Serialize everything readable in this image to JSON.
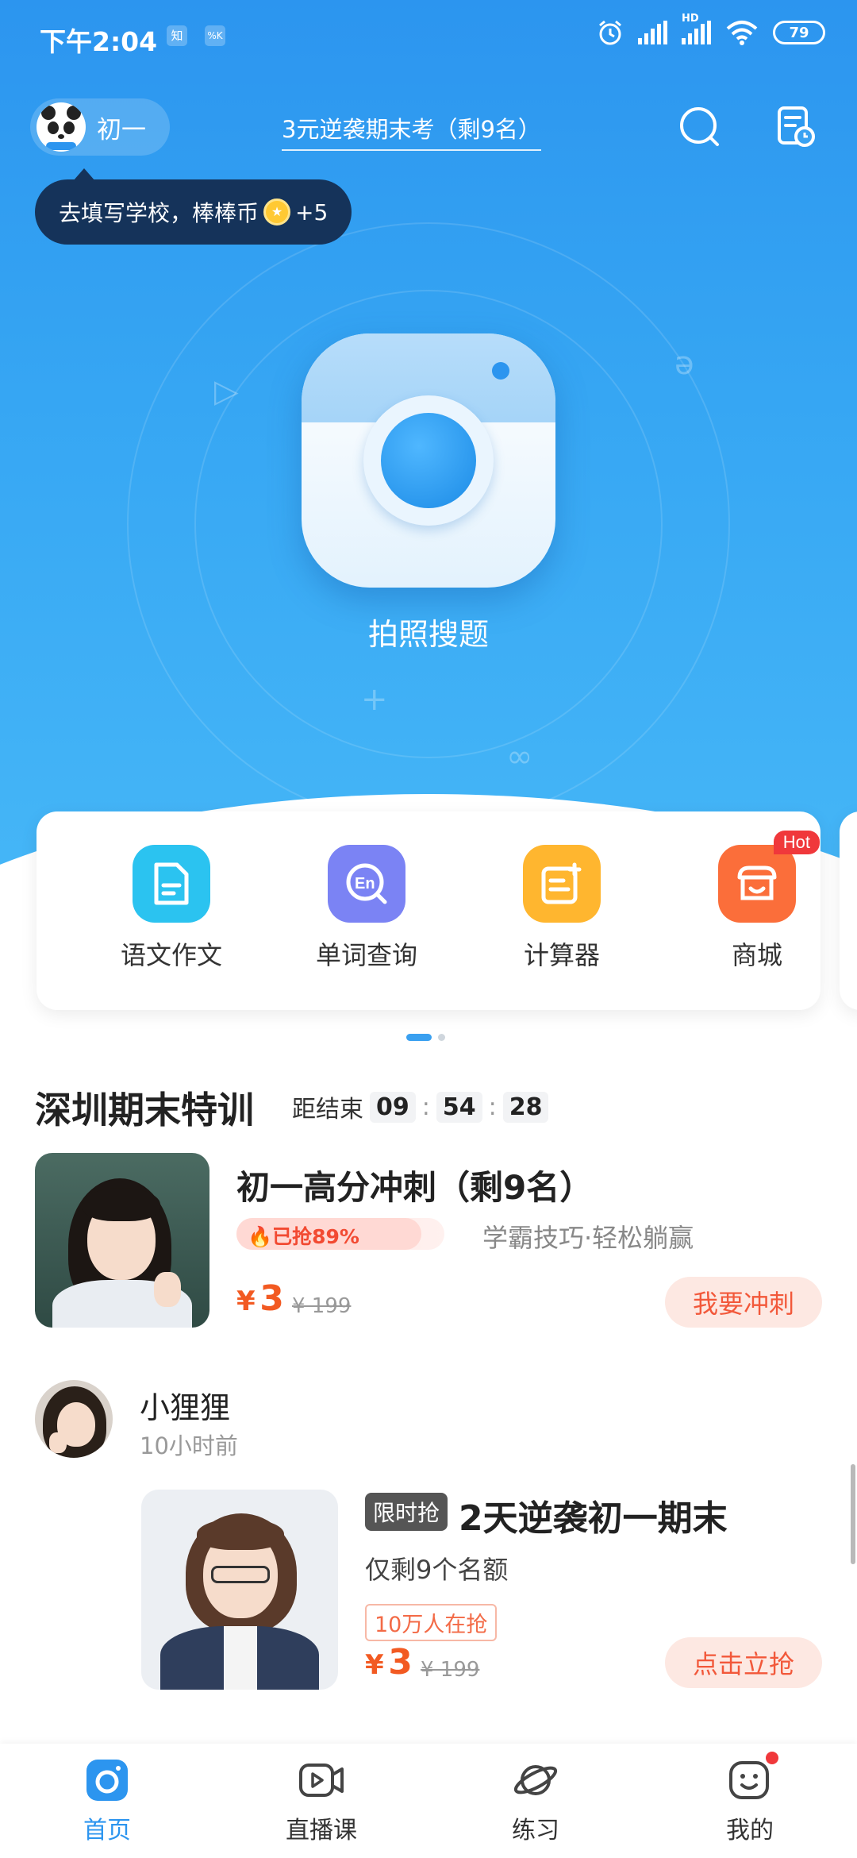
{
  "status_bar": {
    "time": "下午2:04",
    "app_badges": [
      "知",
      "%K"
    ],
    "network_label": "HD",
    "battery": "79"
  },
  "header": {
    "grade": "初一",
    "promo": "3元逆袭期末考（剩9名）",
    "tooltip": "去填写学校，棒棒币",
    "tooltip_bonus": "+5"
  },
  "hero": {
    "camera_label": "拍照搜题"
  },
  "tools": [
    {
      "label": "语文作文",
      "icon": "essay-icon",
      "color": "#2bc3f0"
    },
    {
      "label": "单词查询",
      "icon": "word-lookup-icon",
      "color": "#7b83f4"
    },
    {
      "label": "计算器",
      "icon": "calculator-icon",
      "color": "#ffb62f"
    },
    {
      "label": "商城",
      "icon": "shop-icon",
      "color": "#fb6e3a",
      "badge": "Hot"
    }
  ],
  "section": {
    "title": "深圳期末特训",
    "countdown_label": "距结束",
    "countdown": [
      "09",
      "54",
      "28"
    ]
  },
  "course1": {
    "title": "初一高分冲刺（剩9名）",
    "grabbed": "已抢89%",
    "grabbed_fraction": 0.89,
    "subtitle": "学霸技巧·轻松躺赢",
    "price_symbol": "¥",
    "price": "3",
    "original_price": "¥ 199",
    "cta": "我要冲刺"
  },
  "feed_post": {
    "user": "小狸狸",
    "time": "10小时前",
    "tag": "限时抢",
    "title": "2天逆袭初一期末",
    "subtitle": "仅剩9个名额",
    "people_tag": "10万人在抢",
    "price_symbol": "¥",
    "price": "3",
    "original_price": "¥ 199",
    "cta": "点击立抢"
  },
  "tabbar": [
    {
      "label": "首页",
      "icon": "home-camera-icon",
      "active": true
    },
    {
      "label": "直播课",
      "icon": "live-class-icon",
      "active": false
    },
    {
      "label": "练习",
      "icon": "practice-planet-icon",
      "active": false
    },
    {
      "label": "我的",
      "icon": "profile-face-icon",
      "active": false,
      "dot": true
    }
  ],
  "colors": {
    "brand": "#2c95ef",
    "price": "#f25a22",
    "tooltip_bg": "#15335a",
    "hot": "#f0383b"
  }
}
